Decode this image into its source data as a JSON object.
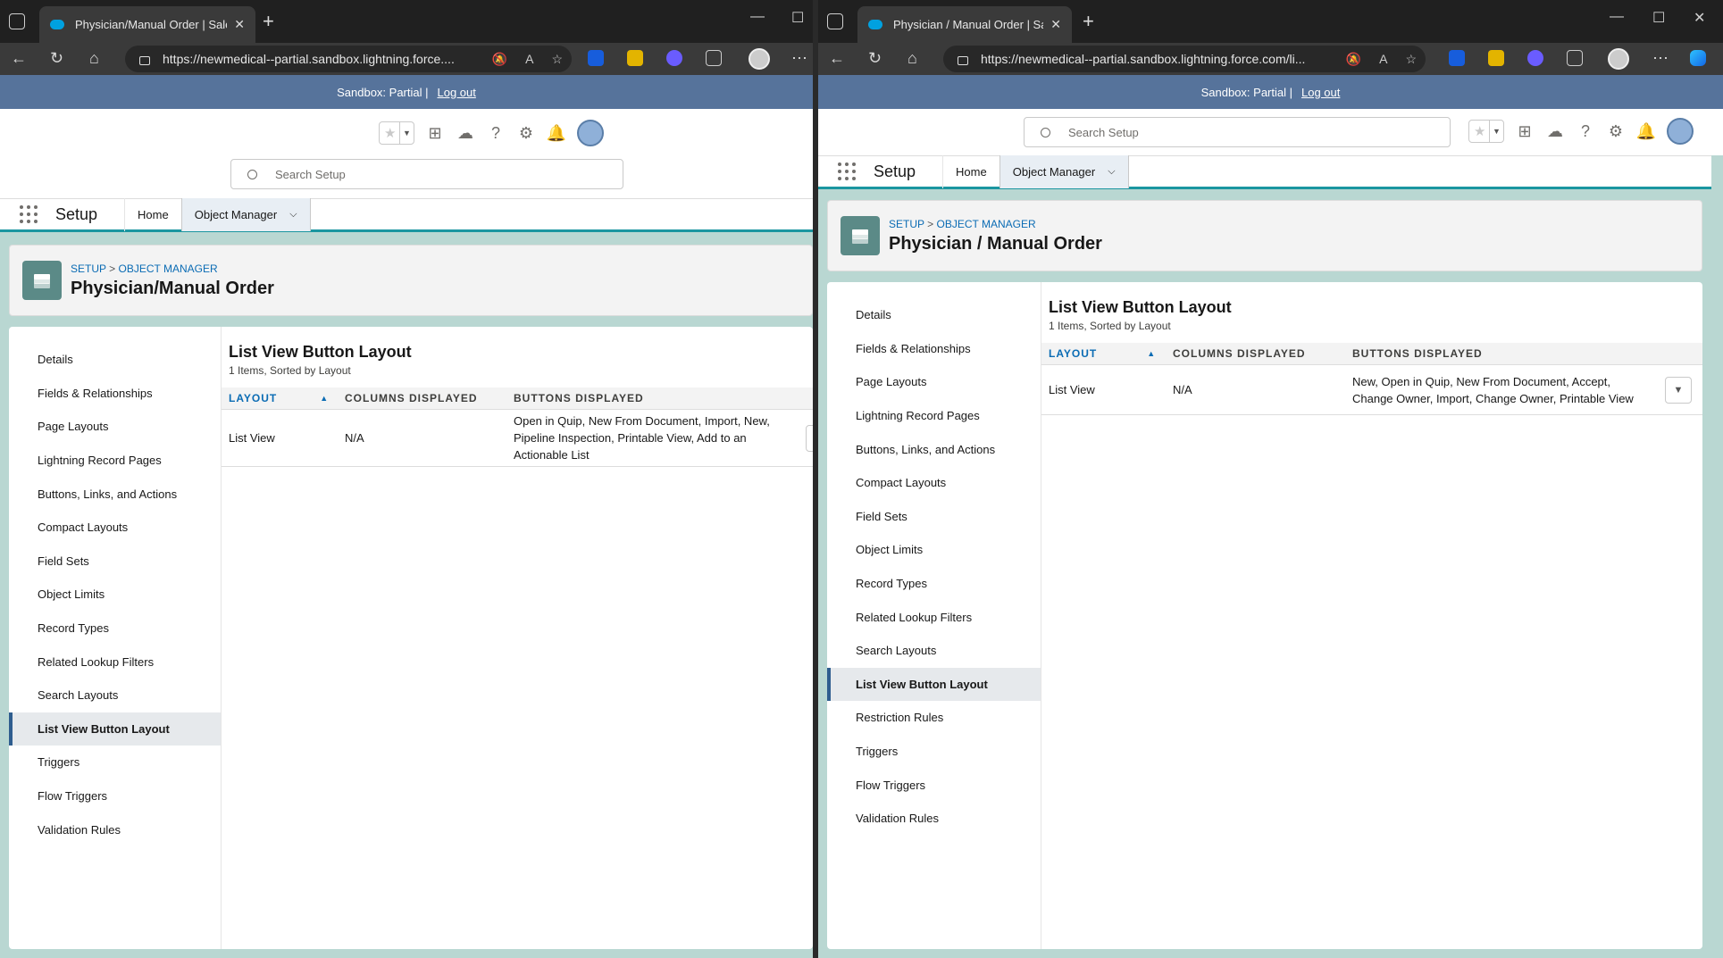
{
  "left": {
    "tab_title": "Physician/Manual Order | Salesfo",
    "url": "https://newmedical--partial.sandbox.lightning.force....",
    "sandbox_label": "Sandbox: Partial |",
    "logout": "Log out",
    "search_placeholder": "Search Setup",
    "app_name": "Setup",
    "nav_home": "Home",
    "nav_object_manager": "Object Manager",
    "crumb_setup": "SETUP",
    "crumb_sep": ">",
    "crumb_om": "OBJECT MANAGER",
    "page_title": "Physician/Manual Order",
    "list_title": "List View Button Layout",
    "list_sub": "1 Items, Sorted by Layout",
    "columns": [
      "LAYOUT",
      "COLUMNS DISPLAYED",
      "BUTTONS DISPLAYED"
    ],
    "row": {
      "layout": "List View",
      "columns": "N/A",
      "buttons": "Open in Quip, New From Document, Import, New, Pipeline Inspection, Printable View, Add to an Actionable List"
    },
    "sidenav": [
      "Details",
      "Fields & Relationships",
      "Page Layouts",
      "Lightning Record Pages",
      "Buttons, Links, and Actions",
      "Compact Layouts",
      "Field Sets",
      "Object Limits",
      "Record Types",
      "Related Lookup Filters",
      "Search Layouts",
      "List View Button Layout",
      "Triggers",
      "Flow Triggers",
      "Validation Rules"
    ],
    "selected": "List View Button Layout"
  },
  "right": {
    "tab_title": "Physician / Manual Order | Salesf",
    "url": "https://newmedical--partial.sandbox.lightning.force.com/li...",
    "sandbox_label": "Sandbox: Partial |",
    "logout": "Log out",
    "search_placeholder": "Search Setup",
    "app_name": "Setup",
    "nav_home": "Home",
    "nav_object_manager": "Object Manager",
    "crumb_setup": "SETUP",
    "crumb_sep": ">",
    "crumb_om": "OBJECT MANAGER",
    "page_title": "Physician / Manual Order",
    "list_title": "List View Button Layout",
    "list_sub": "1 Items, Sorted by Layout",
    "columns": [
      "LAYOUT",
      "COLUMNS DISPLAYED",
      "BUTTONS DISPLAYED"
    ],
    "row": {
      "layout": "List View",
      "columns": "N/A",
      "buttons": "New, Open in Quip, New From Document, Accept, Change Owner, Import, Change Owner, Printable View"
    },
    "sidenav": [
      "Details",
      "Fields & Relationships",
      "Page Layouts",
      "Lightning Record Pages",
      "Buttons, Links, and Actions",
      "Compact Layouts",
      "Field Sets",
      "Object Limits",
      "Record Types",
      "Related Lookup Filters",
      "Search Layouts",
      "List View Button Layout",
      "Restriction Rules",
      "Triggers",
      "Flow Triggers",
      "Validation Rules"
    ],
    "selected": "List View Button Layout"
  },
  "colors": {
    "sandbox_bar": "#56739b",
    "brand_teal": "#1b96a0",
    "link": "#0b6cb4",
    "object_icon": "#5b8a87"
  },
  "icons": [
    "workspaces-icon",
    "salesforce-cloud-icon",
    "back-icon",
    "refresh-icon",
    "home-icon",
    "lock-icon",
    "mute-icon",
    "read-aloud-icon",
    "favorite-star-icon",
    "bitwarden-icon",
    "extension-icon",
    "puzzle-icon",
    "profile-icon",
    "more-icon",
    "search-icon",
    "star-icon",
    "add-icon",
    "trailhead-icon",
    "help-icon",
    "gear-icon",
    "bell-icon",
    "avatar",
    "waffle-icon",
    "chevron-down-icon",
    "layers-icon",
    "sort-up-icon",
    "copilot-icon"
  ]
}
